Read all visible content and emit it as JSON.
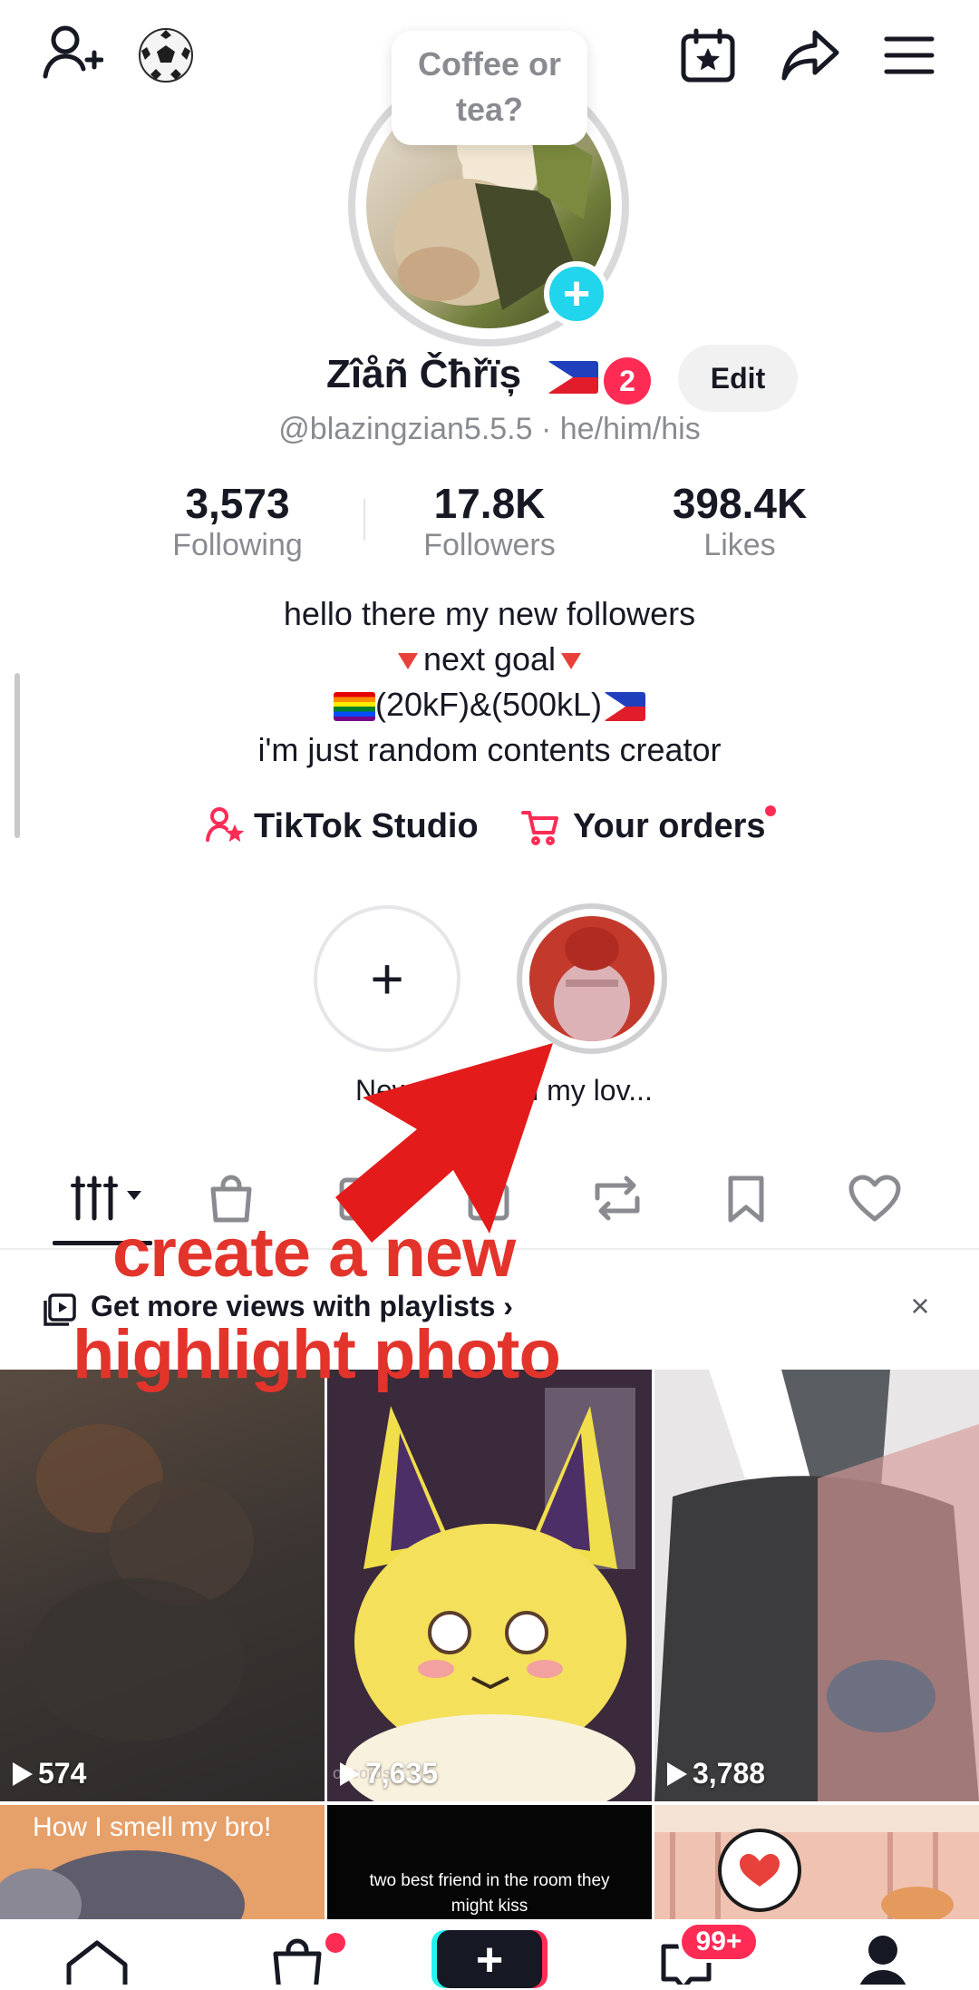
{
  "status_bubble": {
    "text": "Coffee or tea?"
  },
  "profile": {
    "name": "Zîåñ Čħřïș",
    "badge_count": "2",
    "edit_label": "Edit",
    "handle": "@blazingzian5.5.5 · he/him/his"
  },
  "stats": [
    {
      "value": "3,573",
      "label": "Following"
    },
    {
      "value": "17.8K",
      "label": "Followers"
    },
    {
      "value": "398.4K",
      "label": "Likes"
    }
  ],
  "bio": {
    "line1": "hello there my new followers",
    "line2": "next goal",
    "line3": "(20kF)&(500kL)",
    "line4": "i'm just random contents creator"
  },
  "links": {
    "studio": "TikTok Studio",
    "orders": "Your orders"
  },
  "highlights": [
    {
      "label": "New",
      "type": "add"
    },
    {
      "label": "Hi my lov...",
      "type": "photo"
    }
  ],
  "tabs": [
    "videos",
    "shop",
    "repost-collections",
    "saved-drafts",
    "reposts",
    "favorites",
    "liked"
  ],
  "banner": {
    "text": "Get more views with playlists",
    "chevron": "›",
    "close": "×"
  },
  "annotation": {
    "line1": "create a new",
    "line2": "highlight photo"
  },
  "videos": [
    {
      "views": "574"
    },
    {
      "views": "7,635",
      "watermark": "okeords"
    },
    {
      "views": "3,788"
    },
    {
      "caption": "How I smell my bro!"
    },
    {
      "caption": "two best friend in the room they might kiss"
    },
    {
      "caption": ""
    }
  ],
  "bottom_nav": {
    "notifications_badge": "99+",
    "plus": "+"
  },
  "colors": {
    "accent": "#fe2c55",
    "cyan": "#20d5ec",
    "annotation_red": "#e3342c"
  }
}
